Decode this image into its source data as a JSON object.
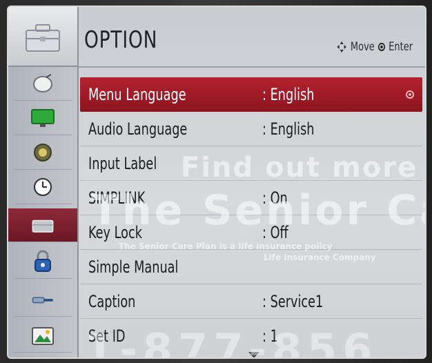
{
  "header": {
    "title": "OPTION",
    "move_hint": "Move",
    "enter_hint": "Enter"
  },
  "sidebar": {
    "items": [
      {
        "icon": "satellite-dish-icon"
      },
      {
        "icon": "monitor-icon"
      },
      {
        "icon": "speaker-icon"
      },
      {
        "icon": "clock-icon"
      },
      {
        "icon": "toolbox-icon",
        "active": true
      },
      {
        "icon": "lock-icon"
      },
      {
        "icon": "input-cable-icon"
      },
      {
        "icon": "photo-icon"
      }
    ]
  },
  "menu": {
    "items": [
      {
        "label": "Menu Language",
        "value": ": English",
        "selected": true
      },
      {
        "label": "Audio Language",
        "value": ": English"
      },
      {
        "label": "Input Label",
        "value": ""
      },
      {
        "label": "SIMPLINK",
        "value": ": On"
      },
      {
        "label": "Key Lock",
        "value": ": Off"
      },
      {
        "label": "Simple Manual",
        "value": ""
      },
      {
        "label": "Caption",
        "value": ": Service1"
      },
      {
        "label": "Set ID",
        "value": ": 1"
      }
    ]
  },
  "watermark": {
    "line1": "Find out more a",
    "line2": "The Senior Ca",
    "line3": "The Senior Care Plan is a life insurance policy",
    "line4": "Life Insurance Company",
    "line5": "1-877-856"
  },
  "colors": {
    "accent_red": "#b5222e",
    "active_sidebar": "#8d2a3a"
  }
}
